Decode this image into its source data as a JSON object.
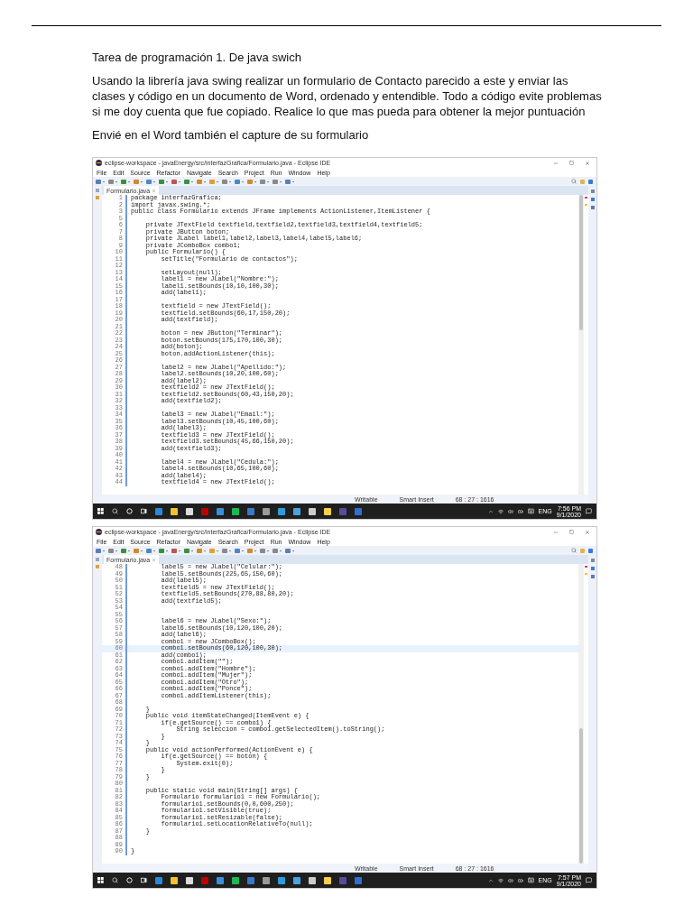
{
  "document": {
    "title": "Tarea de programación 1. De java swich",
    "paragraphs": [
      "Usando la librería java swing realizar un formulario de Contacto parecido a este y enviar las clases y código en un documento de Word, ordenado y entendible. Todo a código evite problemas si me doy cuenta que fue copiado. Realice lo que mas pueda para obtener la mejor puntuación",
      "Envié en el Word también el capture de su formulario"
    ]
  },
  "screenshots": [
    {
      "window_title": "eclipse-workspace - javaEnergy/src/interfazGrafica/Formulario.java - Eclipse IDE",
      "menu": [
        "File",
        "Edit",
        "Source",
        "Refactor",
        "Navigate",
        "Search",
        "Project",
        "Run",
        "Window",
        "Help"
      ],
      "tab": "Formulario.java",
      "lines": [
        {
          "number": "1",
          "code": "package interfazGrafica;",
          "highlighted": false
        },
        {
          "number": "2",
          "code": "import javax.swing.*;",
          "highlighted": false
        },
        {
          "number": "3",
          "code": "public class Formulario extends JFrame implements ActionListener,ItemListener {",
          "highlighted": false
        },
        {
          "number": "5",
          "highlighted": false
        },
        {
          "number": "6",
          "code": "    private JTextField textfield,textfield2,textfield3,textfield4,textfield5;",
          "highlighted": false
        },
        {
          "number": "7",
          "code": "    private JButton boton;",
          "highlighted": false
        },
        {
          "number": "8",
          "code": "    private JLabel label1,label2,label3,label4,label5,label6;",
          "highlighted": false
        },
        {
          "number": "9",
          "code": "    private JComboBox combo1;",
          "highlighted": false
        },
        {
          "number": "10",
          "code": "    public Formulario() {",
          "highlighted": false
        },
        {
          "number": "11",
          "code": "        setTitle(\"Formulario de contactos\");",
          "highlighted": false
        },
        {
          "number": "12",
          "highlighted": false
        },
        {
          "number": "13",
          "code": "        setLayout(null);",
          "highlighted": false
        },
        {
          "number": "14",
          "code": "        label1 = new JLabel(\"Nombre:\");",
          "highlighted": false
        },
        {
          "number": "15",
          "code": "        label1.setBounds(10,10,100,30);",
          "highlighted": false
        },
        {
          "number": "16",
          "code": "        add(label1);",
          "highlighted": false
        },
        {
          "number": "17",
          "highlighted": false
        },
        {
          "number": "18",
          "code": "        textfield = new JTextField();",
          "highlighted": false
        },
        {
          "number": "19",
          "code": "        textfield.setBounds(60,17,150,20);",
          "highlighted": false
        },
        {
          "number": "20",
          "code": "        add(textfield);",
          "highlighted": false
        },
        {
          "number": "21",
          "highlighted": false
        },
        {
          "number": "22",
          "code": "        boton = new JButton(\"Terminar\");",
          "highlighted": false
        },
        {
          "number": "23",
          "code": "        boton.setBounds(175,170,100,30);",
          "highlighted": false
        },
        {
          "number": "24",
          "code": "        add(boton);",
          "highlighted": false
        },
        {
          "number": "25",
          "code": "        boton.addActionListener(this);",
          "highlighted": false
        },
        {
          "number": "26",
          "highlighted": false
        },
        {
          "number": "27",
          "code": "        label2 = new JLabel(\"Apellido:\");",
          "highlighted": false
        },
        {
          "number": "28",
          "code": "        label2.setBounds(10,20,100,60);",
          "highlighted": false
        },
        {
          "number": "29",
          "code": "        add(label2);",
          "highlighted": false
        },
        {
          "number": "30",
          "code": "        textfield2 = new JTextField();",
          "highlighted": false
        },
        {
          "number": "31",
          "code": "        textfield2.setBounds(60,43,150,20);",
          "highlighted": false
        },
        {
          "number": "32",
          "code": "        add(textfield2);",
          "highlighted": false
        },
        {
          "number": "33",
          "highlighted": false
        },
        {
          "number": "34",
          "code": "        label3 = new JLabel(\"Email:\");",
          "highlighted": false
        },
        {
          "number": "35",
          "code": "        label3.setBounds(10,45,100,60);",
          "highlighted": false
        },
        {
          "number": "36",
          "code": "        add(label3);",
          "highlighted": false
        },
        {
          "number": "37",
          "code": "        textfield3 = new JTextField();",
          "highlighted": false
        },
        {
          "number": "38",
          "code": "        textfield3.setBounds(45,66,150,20);",
          "highlighted": false
        },
        {
          "number": "39",
          "code": "        add(textfield3);",
          "highlighted": false
        },
        {
          "number": "40",
          "highlighted": false
        },
        {
          "number": "41",
          "code": "        label4 = new JLabel(\"Cedula:\");",
          "highlighted": false
        },
        {
          "number": "42",
          "code": "        label4.setBounds(10,65,100,60);",
          "highlighted": false
        },
        {
          "number": "43",
          "code": "        add(label4);",
          "highlighted": false
        },
        {
          "number": "44",
          "code": "        textfield4 = new JTextField();",
          "highlighted": false
        }
      ],
      "status": [
        "Writable",
        "Smart Insert",
        "68 : 27 : 1616"
      ],
      "tray": {
        "language": "ENG",
        "time": "7:56 PM",
        "date": "9/1/2020"
      }
    },
    {
      "window_title": "eclipse-workspace - javaEnergy/src/interfazGrafica/Formulario.java - Eclipse IDE",
      "menu": [
        "File",
        "Edit",
        "Source",
        "Refactor",
        "Navigate",
        "Search",
        "Project",
        "Run",
        "Window",
        "Help"
      ],
      "tab": "Formulario.java",
      "lines": [
        {
          "number": "48",
          "code": "        label5 = new JLabel(\"Celular:\");",
          "highlighted": false
        },
        {
          "number": "49",
          "code": "        label5.setBounds(225,65,150,60);",
          "highlighted": false
        },
        {
          "number": "50",
          "code": "        add(label5);",
          "highlighted": false
        },
        {
          "number": "51",
          "code": "        textfield5 = new JTextField();",
          "highlighted": false
        },
        {
          "number": "52",
          "code": "        textfield5.setBounds(270,88,80,20);",
          "highlighted": false
        },
        {
          "number": "53",
          "code": "        add(textfield5);",
          "highlighted": false
        },
        {
          "number": "54",
          "highlighted": false
        },
        {
          "number": "55",
          "highlighted": false
        },
        {
          "number": "56",
          "code": "        label6 = new JLabel(\"Sexo:\");",
          "highlighted": false
        },
        {
          "number": "57",
          "code": "        label6.setBounds(10,120,100,20);",
          "highlighted": false
        },
        {
          "number": "58",
          "code": "        add(label6);",
          "highlighted": false
        },
        {
          "number": "59",
          "code": "        combo1 = new JComboBox();",
          "highlighted": false
        },
        {
          "number": "60",
          "code": "        combo1.setBounds(60,120,100,30);",
          "highlighted": true
        },
        {
          "number": "61",
          "code": "        add(combo1);",
          "highlighted": false
        },
        {
          "number": "62",
          "code": "        combo1.addItem(\"\");",
          "highlighted": false
        },
        {
          "number": "63",
          "code": "        combo1.addItem(\"Hombre\");",
          "highlighted": false
        },
        {
          "number": "64",
          "code": "        combo1.addItem(\"Mujer\");",
          "highlighted": false
        },
        {
          "number": "65",
          "code": "        combo1.addItem(\"Otro\");",
          "highlighted": false
        },
        {
          "number": "66",
          "code": "        combo1.addItem(\"Ponce\");",
          "highlighted": false
        },
        {
          "number": "67",
          "code": "        combo1.addItemListener(this);",
          "highlighted": false
        },
        {
          "number": "68",
          "highlighted": false
        },
        {
          "number": "69",
          "code": "    }",
          "highlighted": false
        },
        {
          "number": "70",
          "code": "    public void itemStateChanged(ItemEvent e) {",
          "highlighted": false
        },
        {
          "number": "71",
          "code": "        if(e.getSource() == combo1) {",
          "highlighted": false
        },
        {
          "number": "72",
          "code": "            String seleccion = combo1.getSelectedItem().toString();",
          "highlighted": false
        },
        {
          "number": "73",
          "code": "        }",
          "highlighted": false
        },
        {
          "number": "74",
          "code": "    }",
          "highlighted": false
        },
        {
          "number": "75",
          "code": "    public void actionPerformed(ActionEvent e) {",
          "highlighted": false
        },
        {
          "number": "76",
          "code": "        if(e.getSource() == boton) {",
          "highlighted": false
        },
        {
          "number": "77",
          "code": "            System.exit(0);",
          "highlighted": false
        },
        {
          "number": "78",
          "code": "        }",
          "highlighted": false
        },
        {
          "number": "79",
          "code": "    }",
          "highlighted": false
        },
        {
          "number": "80",
          "highlighted": false
        },
        {
          "number": "81",
          "code": "    public static void main(String[] args) {",
          "highlighted": false
        },
        {
          "number": "82",
          "code": "        Formulario formulario1 = new Formulario();",
          "highlighted": false
        },
        {
          "number": "83",
          "code": "        formulario1.setBounds(0,0,600,250);",
          "highlighted": false
        },
        {
          "number": "84",
          "code": "        formulario1.setVisible(true);",
          "highlighted": false
        },
        {
          "number": "85",
          "code": "        formulario1.setResizable(false);",
          "highlighted": false
        },
        {
          "number": "86",
          "code": "        formulario1.setLocationRelativeTo(null);",
          "highlighted": false
        },
        {
          "number": "87",
          "code": "    }",
          "highlighted": false
        },
        {
          "number": "88",
          "highlighted": false
        },
        {
          "number": "89",
          "highlighted": false
        },
        {
          "number": "90",
          "code": "}",
          "highlighted": false
        }
      ],
      "status": [
        "Writable",
        "Smart Insert",
        "68 : 27 : 1616"
      ],
      "tray": {
        "language": "ENG",
        "time": "7:57 PM",
        "date": "9/1/2020"
      }
    }
  ]
}
